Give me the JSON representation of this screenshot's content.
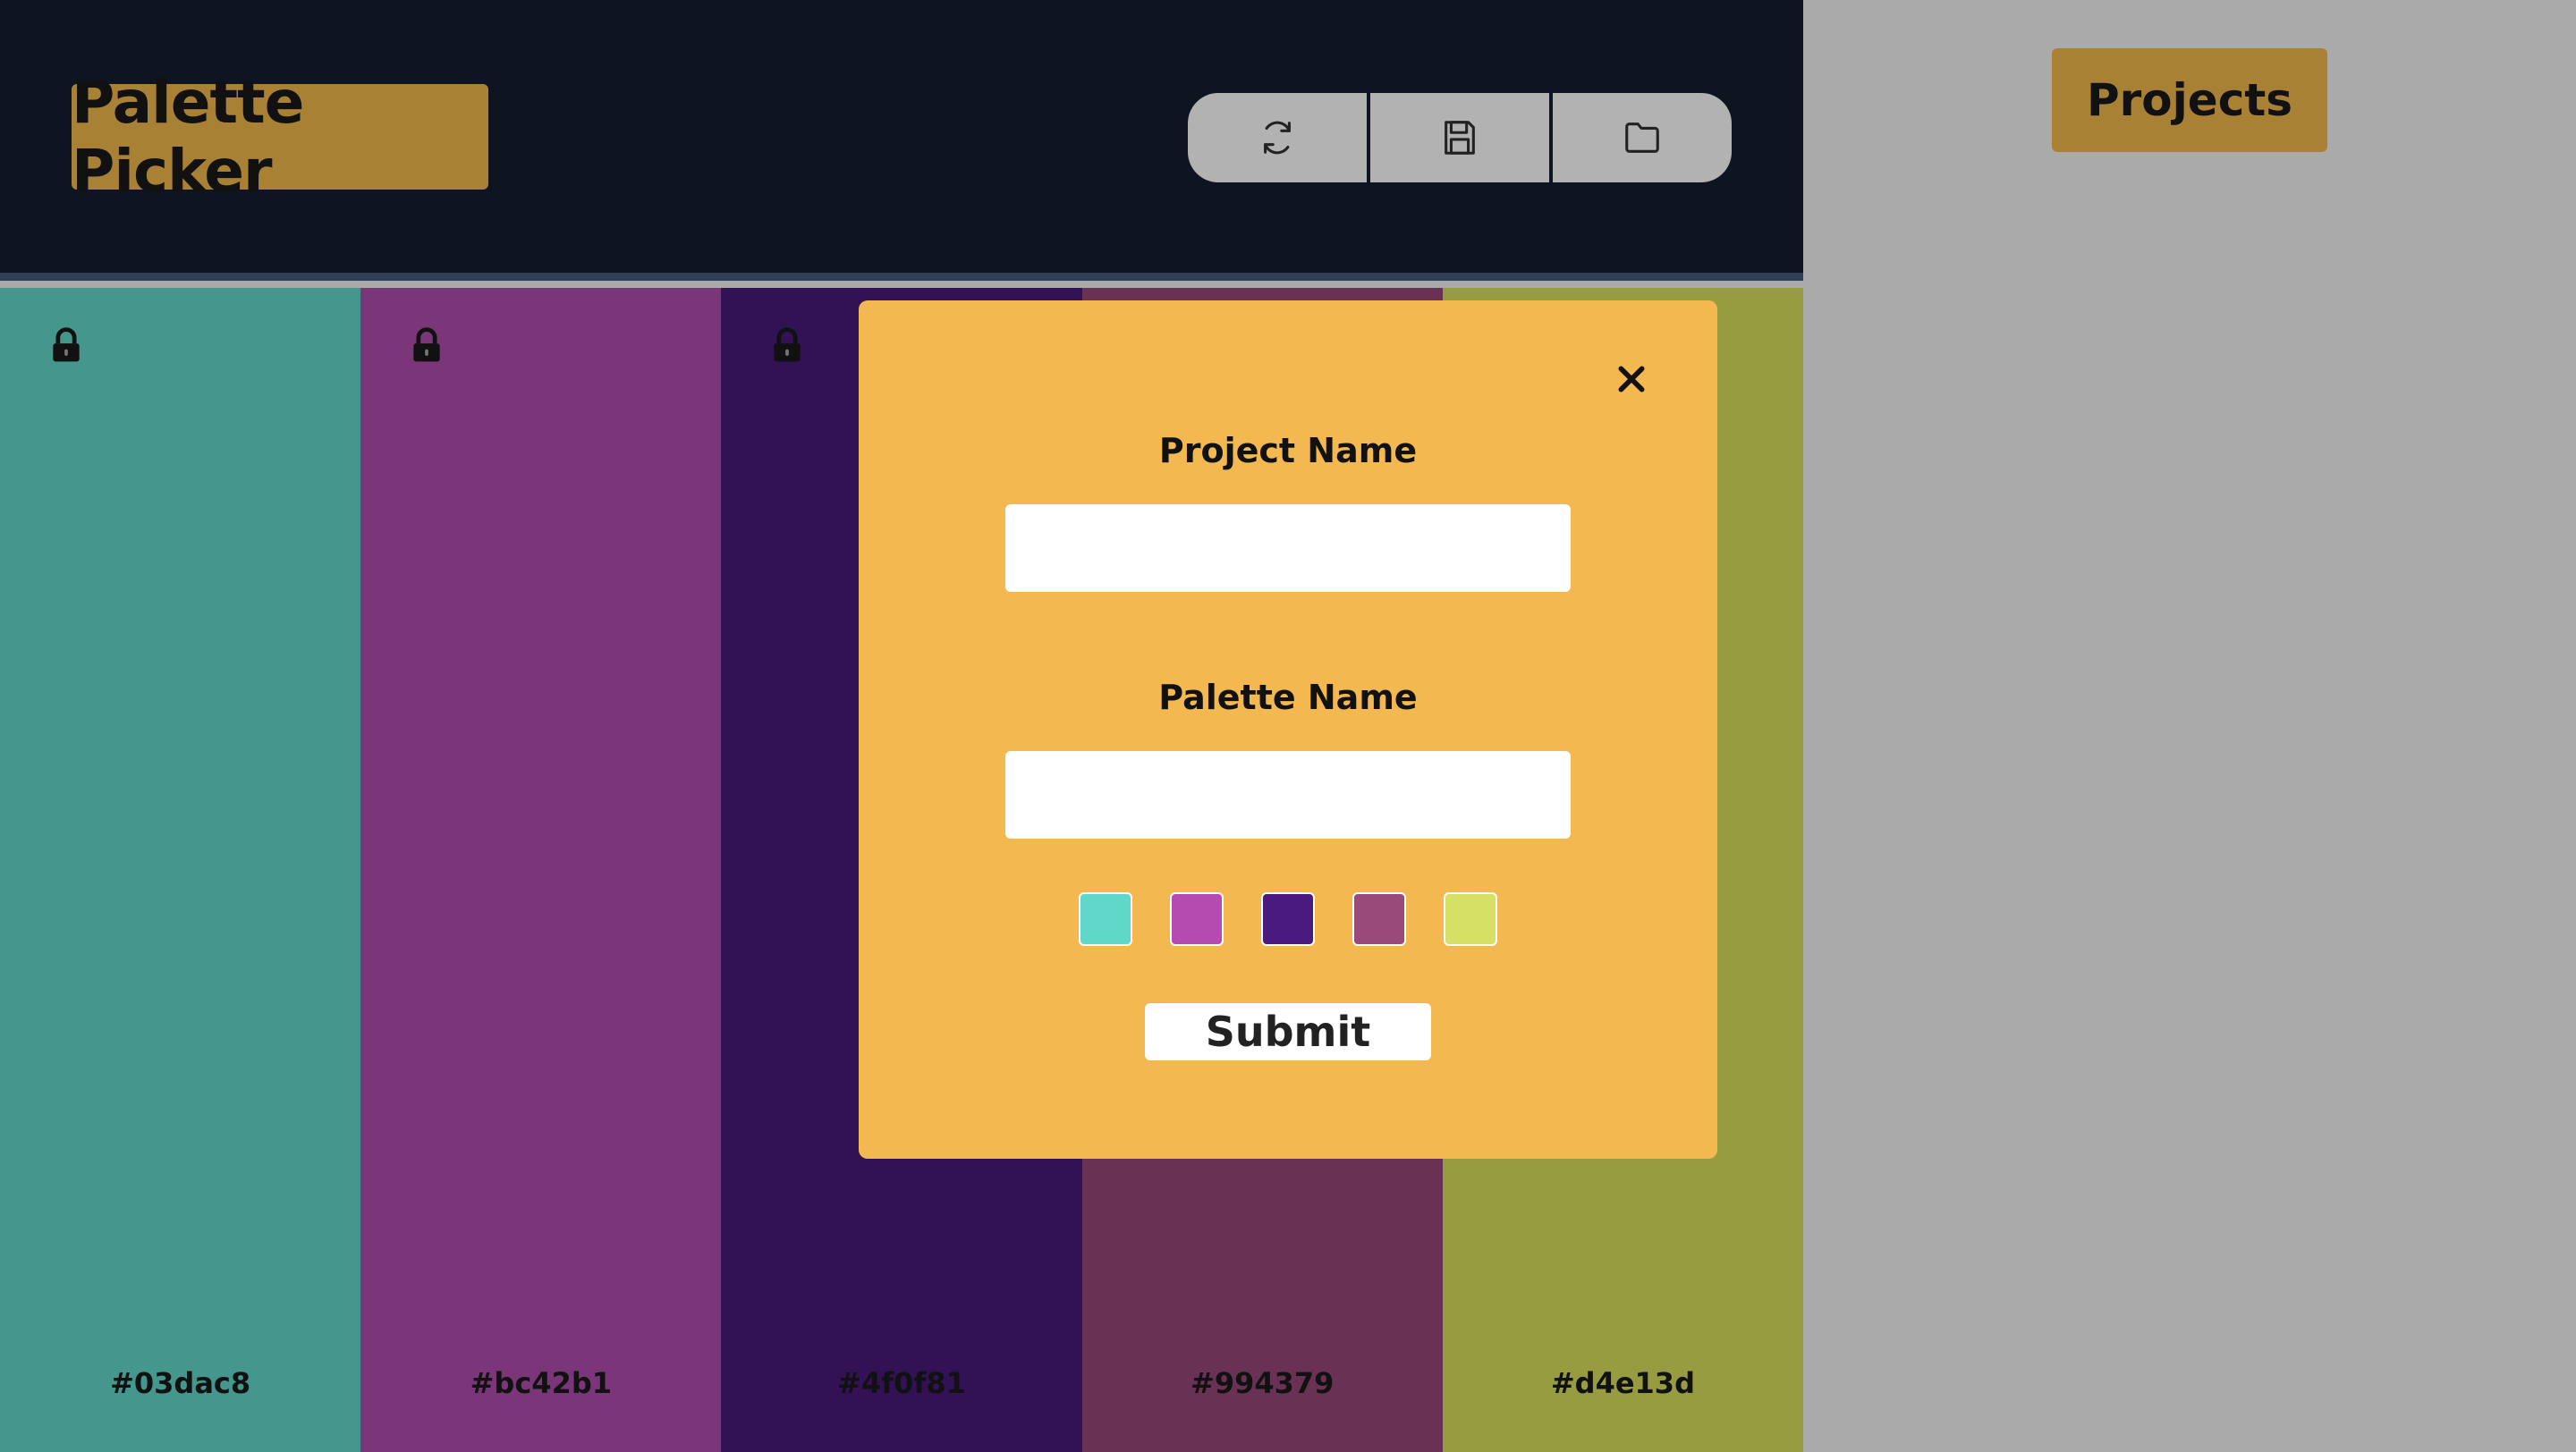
{
  "header": {
    "logo": "Palette Picker",
    "tools": [
      {
        "name": "regenerate-icon"
      },
      {
        "name": "save-icon"
      },
      {
        "name": "folder-icon"
      }
    ]
  },
  "palette": {
    "colors": [
      {
        "hex": "#03dac8",
        "bg": "#45968d",
        "locked": true
      },
      {
        "hex": "#bc42b1",
        "bg": "#7a3679",
        "locked": true
      },
      {
        "hex": "#4f0f81",
        "bg": "#321155",
        "locked": true
      },
      {
        "hex": "#994379",
        "bg": "#693254",
        "locked": true
      },
      {
        "hex": "#d4e13d",
        "bg": "#979c41",
        "locked": true
      }
    ]
  },
  "modal": {
    "project_label": "Project Name",
    "project_value": "",
    "palette_label": "Palette Name",
    "palette_value": "",
    "swatches": [
      "#5fd7c9",
      "#b54ab0",
      "#4a1a7e",
      "#994a7a",
      "#d6e064"
    ],
    "submit_label": "Submit",
    "close_icon": "close-icon"
  },
  "sidebar": {
    "projects_label": "Projects",
    "background": "#aaaaaa"
  }
}
